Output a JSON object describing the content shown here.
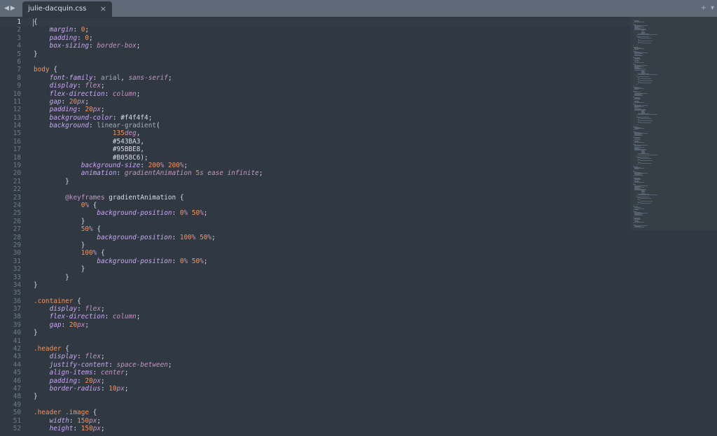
{
  "window": {
    "tab_title": "julie-dacquin.css",
    "back_arrow_icon": "chevron-left",
    "forward_arrow_icon": "chevron-right",
    "tab_close_label": "×",
    "new_tab_label": "+",
    "tab_menu_label": "▾"
  },
  "editor": {
    "active_line": 1,
    "lines": [
      [
        [
          "p",
          "{"
        ]
      ],
      [
        [
          "p",
          "    "
        ],
        [
          "k",
          "margin"
        ],
        [
          "p",
          ": "
        ],
        [
          "n",
          "0"
        ],
        [
          "p",
          ";"
        ]
      ],
      [
        [
          "p",
          "    "
        ],
        [
          "k",
          "padding"
        ],
        [
          "p",
          ": "
        ],
        [
          "n",
          "0"
        ],
        [
          "p",
          ";"
        ]
      ],
      [
        [
          "p",
          "    "
        ],
        [
          "k",
          "box-sizing"
        ],
        [
          "p",
          ": "
        ],
        [
          "v",
          "border-box"
        ],
        [
          "p",
          ";"
        ]
      ],
      [
        [
          "p",
          "}"
        ]
      ],
      [
        [
          "p",
          ""
        ]
      ],
      [
        [
          "s",
          "body"
        ],
        [
          "p",
          " {"
        ]
      ],
      [
        [
          "p",
          "    "
        ],
        [
          "k",
          "font-family"
        ],
        [
          "p",
          ": "
        ],
        [
          "unk",
          "arial"
        ],
        [
          "p",
          ", "
        ],
        [
          "v",
          "sans-serif"
        ],
        [
          "p",
          ";"
        ]
      ],
      [
        [
          "p",
          "    "
        ],
        [
          "k",
          "display"
        ],
        [
          "p",
          ": "
        ],
        [
          "v",
          "flex"
        ],
        [
          "p",
          ";"
        ]
      ],
      [
        [
          "p",
          "    "
        ],
        [
          "k",
          "flex-direction"
        ],
        [
          "p",
          ": "
        ],
        [
          "v",
          "column"
        ],
        [
          "p",
          ";"
        ]
      ],
      [
        [
          "p",
          "    "
        ],
        [
          "k",
          "gap"
        ],
        [
          "p",
          ": "
        ],
        [
          "n",
          "20"
        ],
        [
          "u",
          "px"
        ],
        [
          "p",
          ";"
        ]
      ],
      [
        [
          "p",
          "    "
        ],
        [
          "k",
          "padding"
        ],
        [
          "p",
          ": "
        ],
        [
          "n",
          "20"
        ],
        [
          "u",
          "px"
        ],
        [
          "p",
          ";"
        ]
      ],
      [
        [
          "p",
          "    "
        ],
        [
          "k",
          "background-color"
        ],
        [
          "p",
          ": "
        ],
        [
          "h",
          "#f4f4f4"
        ],
        [
          "p",
          ";"
        ]
      ],
      [
        [
          "p",
          "    "
        ],
        [
          "k",
          "background"
        ],
        [
          "p",
          ": "
        ],
        [
          "unk",
          "linear-gradient"
        ],
        [
          "p",
          "("
        ]
      ],
      [
        [
          "p",
          "                    "
        ],
        [
          "n",
          "135"
        ],
        [
          "u",
          "deg"
        ],
        [
          "p",
          ","
        ]
      ],
      [
        [
          "p",
          "                    "
        ],
        [
          "h",
          "#543BA3"
        ],
        [
          "p",
          ","
        ]
      ],
      [
        [
          "p",
          "                    "
        ],
        [
          "h",
          "#95BBE8"
        ],
        [
          "p",
          ","
        ]
      ],
      [
        [
          "p",
          "                    "
        ],
        [
          "h",
          "#B058C6"
        ],
        [
          "p",
          ");"
        ]
      ],
      [
        [
          "p",
          "            "
        ],
        [
          "k",
          "background-size"
        ],
        [
          "p",
          ": "
        ],
        [
          "n",
          "200"
        ],
        [
          "u",
          "%"
        ],
        [
          "p",
          " "
        ],
        [
          "n",
          "200"
        ],
        [
          "u",
          "%"
        ],
        [
          "p",
          ";"
        ]
      ],
      [
        [
          "p",
          "            "
        ],
        [
          "k",
          "animation"
        ],
        [
          "p",
          ": "
        ],
        [
          "v",
          "gradientAnimation"
        ],
        [
          "p",
          " "
        ],
        [
          "n",
          "5"
        ],
        [
          "u",
          "s"
        ],
        [
          "p",
          " "
        ],
        [
          "v",
          "ease"
        ],
        [
          "p",
          " "
        ],
        [
          "v",
          "infinite"
        ],
        [
          "p",
          ";"
        ]
      ],
      [
        [
          "p",
          "        }"
        ]
      ],
      [
        [
          "p",
          ""
        ]
      ],
      [
        [
          "p",
          "        "
        ],
        [
          "at",
          "@keyframes"
        ],
        [
          "p",
          " gradientAnimation {"
        ]
      ],
      [
        [
          "p",
          "            "
        ],
        [
          "n",
          "0"
        ],
        [
          "u",
          "%"
        ],
        [
          "p",
          " {"
        ]
      ],
      [
        [
          "p",
          "                "
        ],
        [
          "k",
          "background-position"
        ],
        [
          "p",
          ": "
        ],
        [
          "n",
          "0"
        ],
        [
          "u",
          "%"
        ],
        [
          "p",
          " "
        ],
        [
          "n",
          "50"
        ],
        [
          "u",
          "%"
        ],
        [
          "p",
          ";"
        ]
      ],
      [
        [
          "p",
          "            }"
        ]
      ],
      [
        [
          "p",
          "            "
        ],
        [
          "n",
          "50"
        ],
        [
          "u",
          "%"
        ],
        [
          "p",
          " {"
        ]
      ],
      [
        [
          "p",
          "                "
        ],
        [
          "k",
          "background-position"
        ],
        [
          "p",
          ": "
        ],
        [
          "n",
          "100"
        ],
        [
          "u",
          "%"
        ],
        [
          "p",
          " "
        ],
        [
          "n",
          "50"
        ],
        [
          "u",
          "%"
        ],
        [
          "p",
          ";"
        ]
      ],
      [
        [
          "p",
          "            }"
        ]
      ],
      [
        [
          "p",
          "            "
        ],
        [
          "n",
          "100"
        ],
        [
          "u",
          "%"
        ],
        [
          "p",
          " {"
        ]
      ],
      [
        [
          "p",
          "                "
        ],
        [
          "k",
          "background-position"
        ],
        [
          "p",
          ": "
        ],
        [
          "n",
          "0"
        ],
        [
          "u",
          "%"
        ],
        [
          "p",
          " "
        ],
        [
          "n",
          "50"
        ],
        [
          "u",
          "%"
        ],
        [
          "p",
          ";"
        ]
      ],
      [
        [
          "p",
          "            }"
        ]
      ],
      [
        [
          "p",
          "        }"
        ]
      ],
      [
        [
          "p",
          "}"
        ]
      ],
      [
        [
          "p",
          ""
        ]
      ],
      [
        [
          "s",
          ".container"
        ],
        [
          "p",
          " {"
        ]
      ],
      [
        [
          "p",
          "    "
        ],
        [
          "k",
          "display"
        ],
        [
          "p",
          ": "
        ],
        [
          "v",
          "flex"
        ],
        [
          "p",
          ";"
        ]
      ],
      [
        [
          "p",
          "    "
        ],
        [
          "k",
          "flex-direction"
        ],
        [
          "p",
          ": "
        ],
        [
          "v",
          "column"
        ],
        [
          "p",
          ";"
        ]
      ],
      [
        [
          "p",
          "    "
        ],
        [
          "k",
          "gap"
        ],
        [
          "p",
          ": "
        ],
        [
          "n",
          "20"
        ],
        [
          "u",
          "px"
        ],
        [
          "p",
          ";"
        ]
      ],
      [
        [
          "p",
          "}"
        ]
      ],
      [
        [
          "p",
          ""
        ]
      ],
      [
        [
          "s",
          ".header"
        ],
        [
          "p",
          " {"
        ]
      ],
      [
        [
          "p",
          "    "
        ],
        [
          "k",
          "display"
        ],
        [
          "p",
          ": "
        ],
        [
          "v",
          "flex"
        ],
        [
          "p",
          ";"
        ]
      ],
      [
        [
          "p",
          "    "
        ],
        [
          "k",
          "justify-content"
        ],
        [
          "p",
          ": "
        ],
        [
          "v",
          "space-between"
        ],
        [
          "p",
          ";"
        ]
      ],
      [
        [
          "p",
          "    "
        ],
        [
          "k",
          "align-items"
        ],
        [
          "p",
          ": "
        ],
        [
          "v",
          "center"
        ],
        [
          "p",
          ";"
        ]
      ],
      [
        [
          "p",
          "    "
        ],
        [
          "k",
          "padding"
        ],
        [
          "p",
          ": "
        ],
        [
          "n",
          "20"
        ],
        [
          "u",
          "px"
        ],
        [
          "p",
          ";"
        ]
      ],
      [
        [
          "p",
          "    "
        ],
        [
          "k",
          "border-radius"
        ],
        [
          "p",
          ": "
        ],
        [
          "n",
          "10"
        ],
        [
          "u",
          "px"
        ],
        [
          "p",
          ";"
        ]
      ],
      [
        [
          "p",
          "}"
        ]
      ],
      [
        [
          "p",
          ""
        ]
      ],
      [
        [
          "s",
          ".header .image"
        ],
        [
          "p",
          " {"
        ]
      ],
      [
        [
          "p",
          "    "
        ],
        [
          "k",
          "width"
        ],
        [
          "p",
          ": "
        ],
        [
          "n",
          "150"
        ],
        [
          "u",
          "px"
        ],
        [
          "p",
          ";"
        ]
      ],
      [
        [
          "p",
          "    "
        ],
        [
          "k",
          "height"
        ],
        [
          "p",
          ": "
        ],
        [
          "n",
          "150"
        ],
        [
          "u",
          "px"
        ],
        [
          "p",
          ";"
        ]
      ]
    ]
  },
  "colors": {
    "background": "#303841",
    "tabbar": "#5e6a78",
    "gutter_text": "#6f7b89",
    "property": "#cba6f7",
    "value": "#c594c5",
    "number": "#f99157",
    "selector": "#f99157",
    "text": "#d8dee9"
  }
}
